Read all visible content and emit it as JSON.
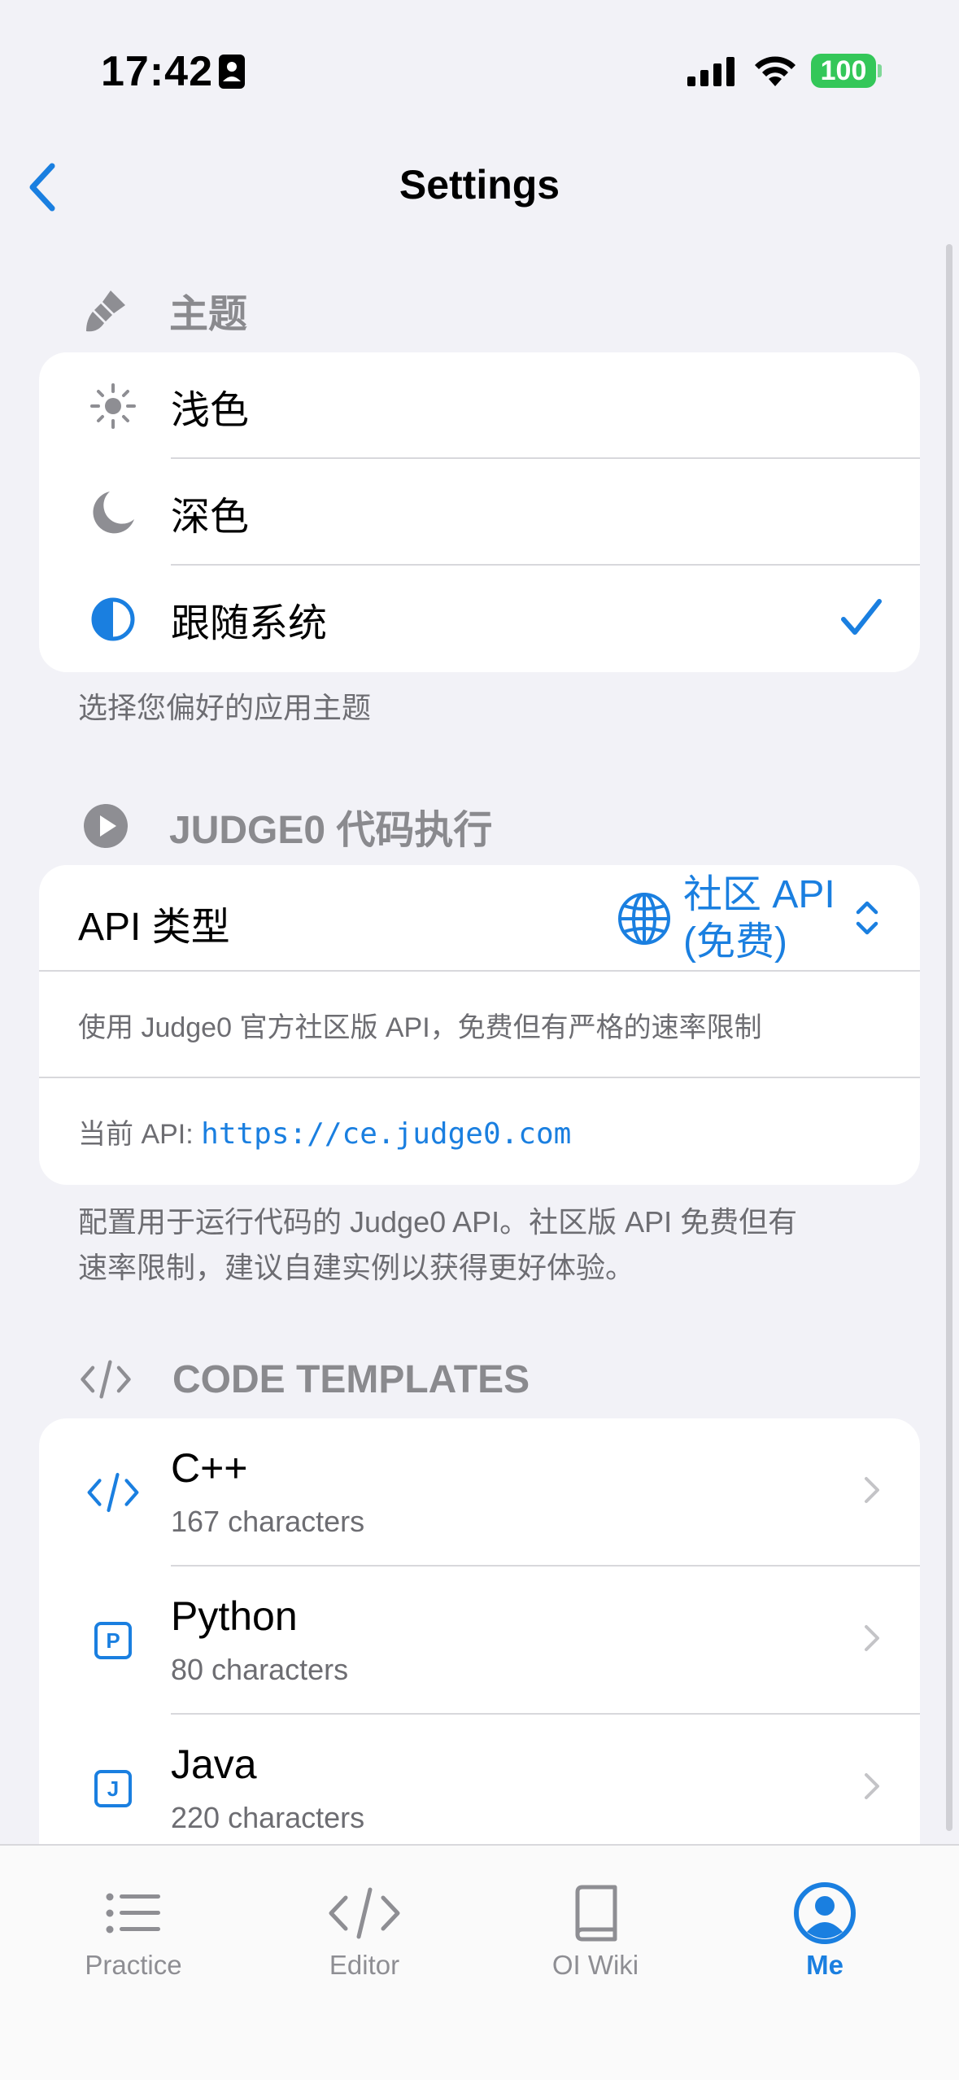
{
  "status": {
    "time": "17:42",
    "battery": "100"
  },
  "nav": {
    "title": "Settings"
  },
  "theme": {
    "header": "主题",
    "options": [
      {
        "label": "浅色",
        "icon": "sun-icon",
        "selected": false
      },
      {
        "label": "深色",
        "icon": "moon-icon",
        "selected": false
      },
      {
        "label": "跟随系统",
        "icon": "half-circle-icon",
        "selected": true
      }
    ],
    "footer": "选择您偏好的应用主题"
  },
  "judge0": {
    "header": "JUDGE0 代码执行",
    "api_type_label": "API 类型",
    "api_type_value": "社区 API (免费)",
    "description": "使用 Judge0 官方社区版 API，免费但有严格的速率限制",
    "current_api_label": "当前 API:",
    "current_api_url": "https://ce.judge0.com",
    "footer_line1": "配置用于运行代码的 Judge0 API。社区版 API 免费但有",
    "footer_line2": "速率限制，建议自建实例以获得更好体验。"
  },
  "templates": {
    "header": "CODE TEMPLATES",
    "items": [
      {
        "name": "C++",
        "meta": "167 characters",
        "icon": "code-icon"
      },
      {
        "name": "Python",
        "meta": "80 characters",
        "icon": "p-square-icon"
      },
      {
        "name": "Java",
        "meta": "220 characters",
        "icon": "j-square-icon"
      }
    ]
  },
  "tabs": [
    {
      "label": "Practice",
      "icon": "list-icon",
      "active": false
    },
    {
      "label": "Editor",
      "icon": "code-icon",
      "active": false
    },
    {
      "label": "OI Wiki",
      "icon": "book-icon",
      "active": false
    },
    {
      "label": "Me",
      "icon": "person-circle-icon",
      "active": true
    }
  ],
  "colors": {
    "accent": "#1a7fe0",
    "background": "#f2f2f7",
    "secondary": "#8e8e93",
    "battery": "#34c759"
  }
}
